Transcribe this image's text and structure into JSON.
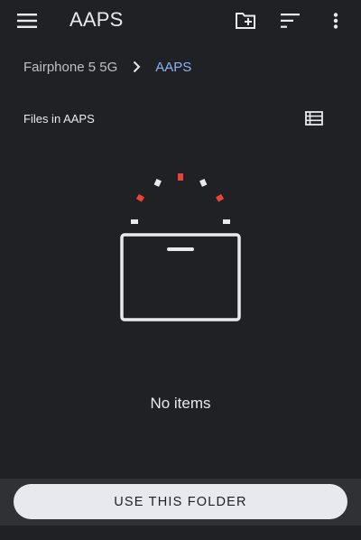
{
  "app": {
    "title": "AAPS"
  },
  "toolbar": {
    "menu_icon": "menu-icon",
    "new_folder_icon": "create-new-folder-icon",
    "sort_icon": "sort-icon",
    "overflow_icon": "more-vert-icon"
  },
  "breadcrumb": {
    "root": "Fairphone 5 5G",
    "current": "AAPS"
  },
  "section": {
    "title": "Files in AAPS",
    "view_toggle_icon": "list-view-icon"
  },
  "empty_state": {
    "message": "No items",
    "illustration": "empty-box-icon"
  },
  "footer": {
    "button_label": "USE THIS FOLDER"
  },
  "colors": {
    "background": "#202124",
    "text": "#e8eaed",
    "breadcrumb_current": "#8ab4f8",
    "accent_red": "#ea4335",
    "button_bg": "#e8e8ef",
    "bottom_bar": "#303134"
  }
}
